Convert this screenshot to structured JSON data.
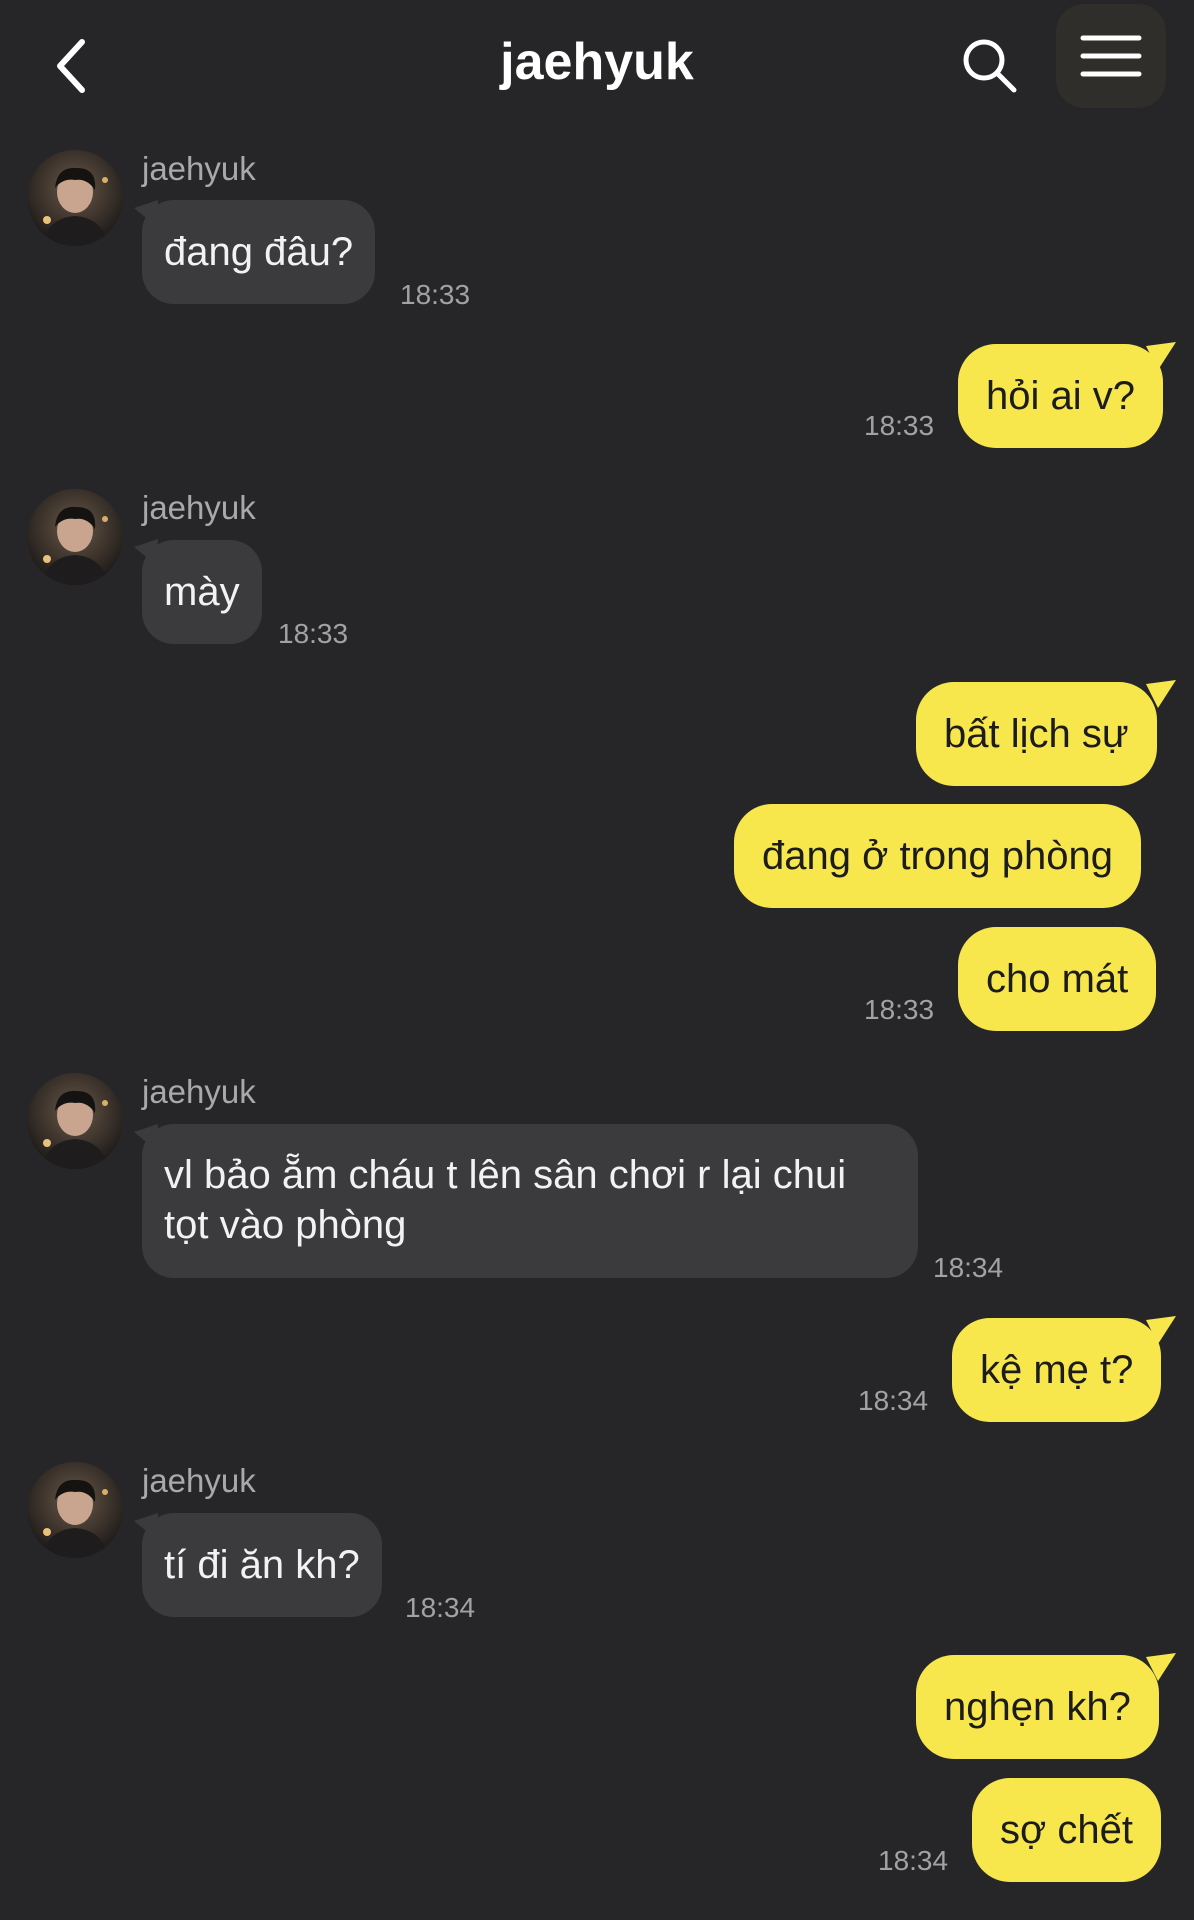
{
  "header": {
    "title": "jaehyuk"
  },
  "colors": {
    "background": "#262628",
    "incoming_bubble": "#3b3b3e",
    "outgoing_bubble": "#f7e64c"
  },
  "icons": {
    "back": "chevron-left-icon",
    "search": "search-icon",
    "menu": "hamburger-menu-icon"
  },
  "messages": [
    {
      "sender": "jaehyuk",
      "text": "đang đâu?",
      "time": "18:33"
    },
    {
      "text": "hỏi ai v?",
      "time": "18:33"
    },
    {
      "sender": "jaehyuk",
      "text": "mày",
      "time": "18:33"
    },
    {
      "text": "bất lịch sự"
    },
    {
      "text": "đang ở trong phòng"
    },
    {
      "text": "cho mát",
      "time": "18:33"
    },
    {
      "sender": "jaehyuk",
      "text": "vl bảo ẵm cháu t lên sân chơi r lại chui tọt vào phòng",
      "time": "18:34"
    },
    {
      "text": "kệ mẹ t?",
      "time": "18:34"
    },
    {
      "sender": "jaehyuk",
      "text": "tí đi ăn kh?",
      "time": "18:34"
    },
    {
      "text": "nghẹn kh?"
    },
    {
      "text": "sợ chết",
      "time": "18:34"
    }
  ]
}
